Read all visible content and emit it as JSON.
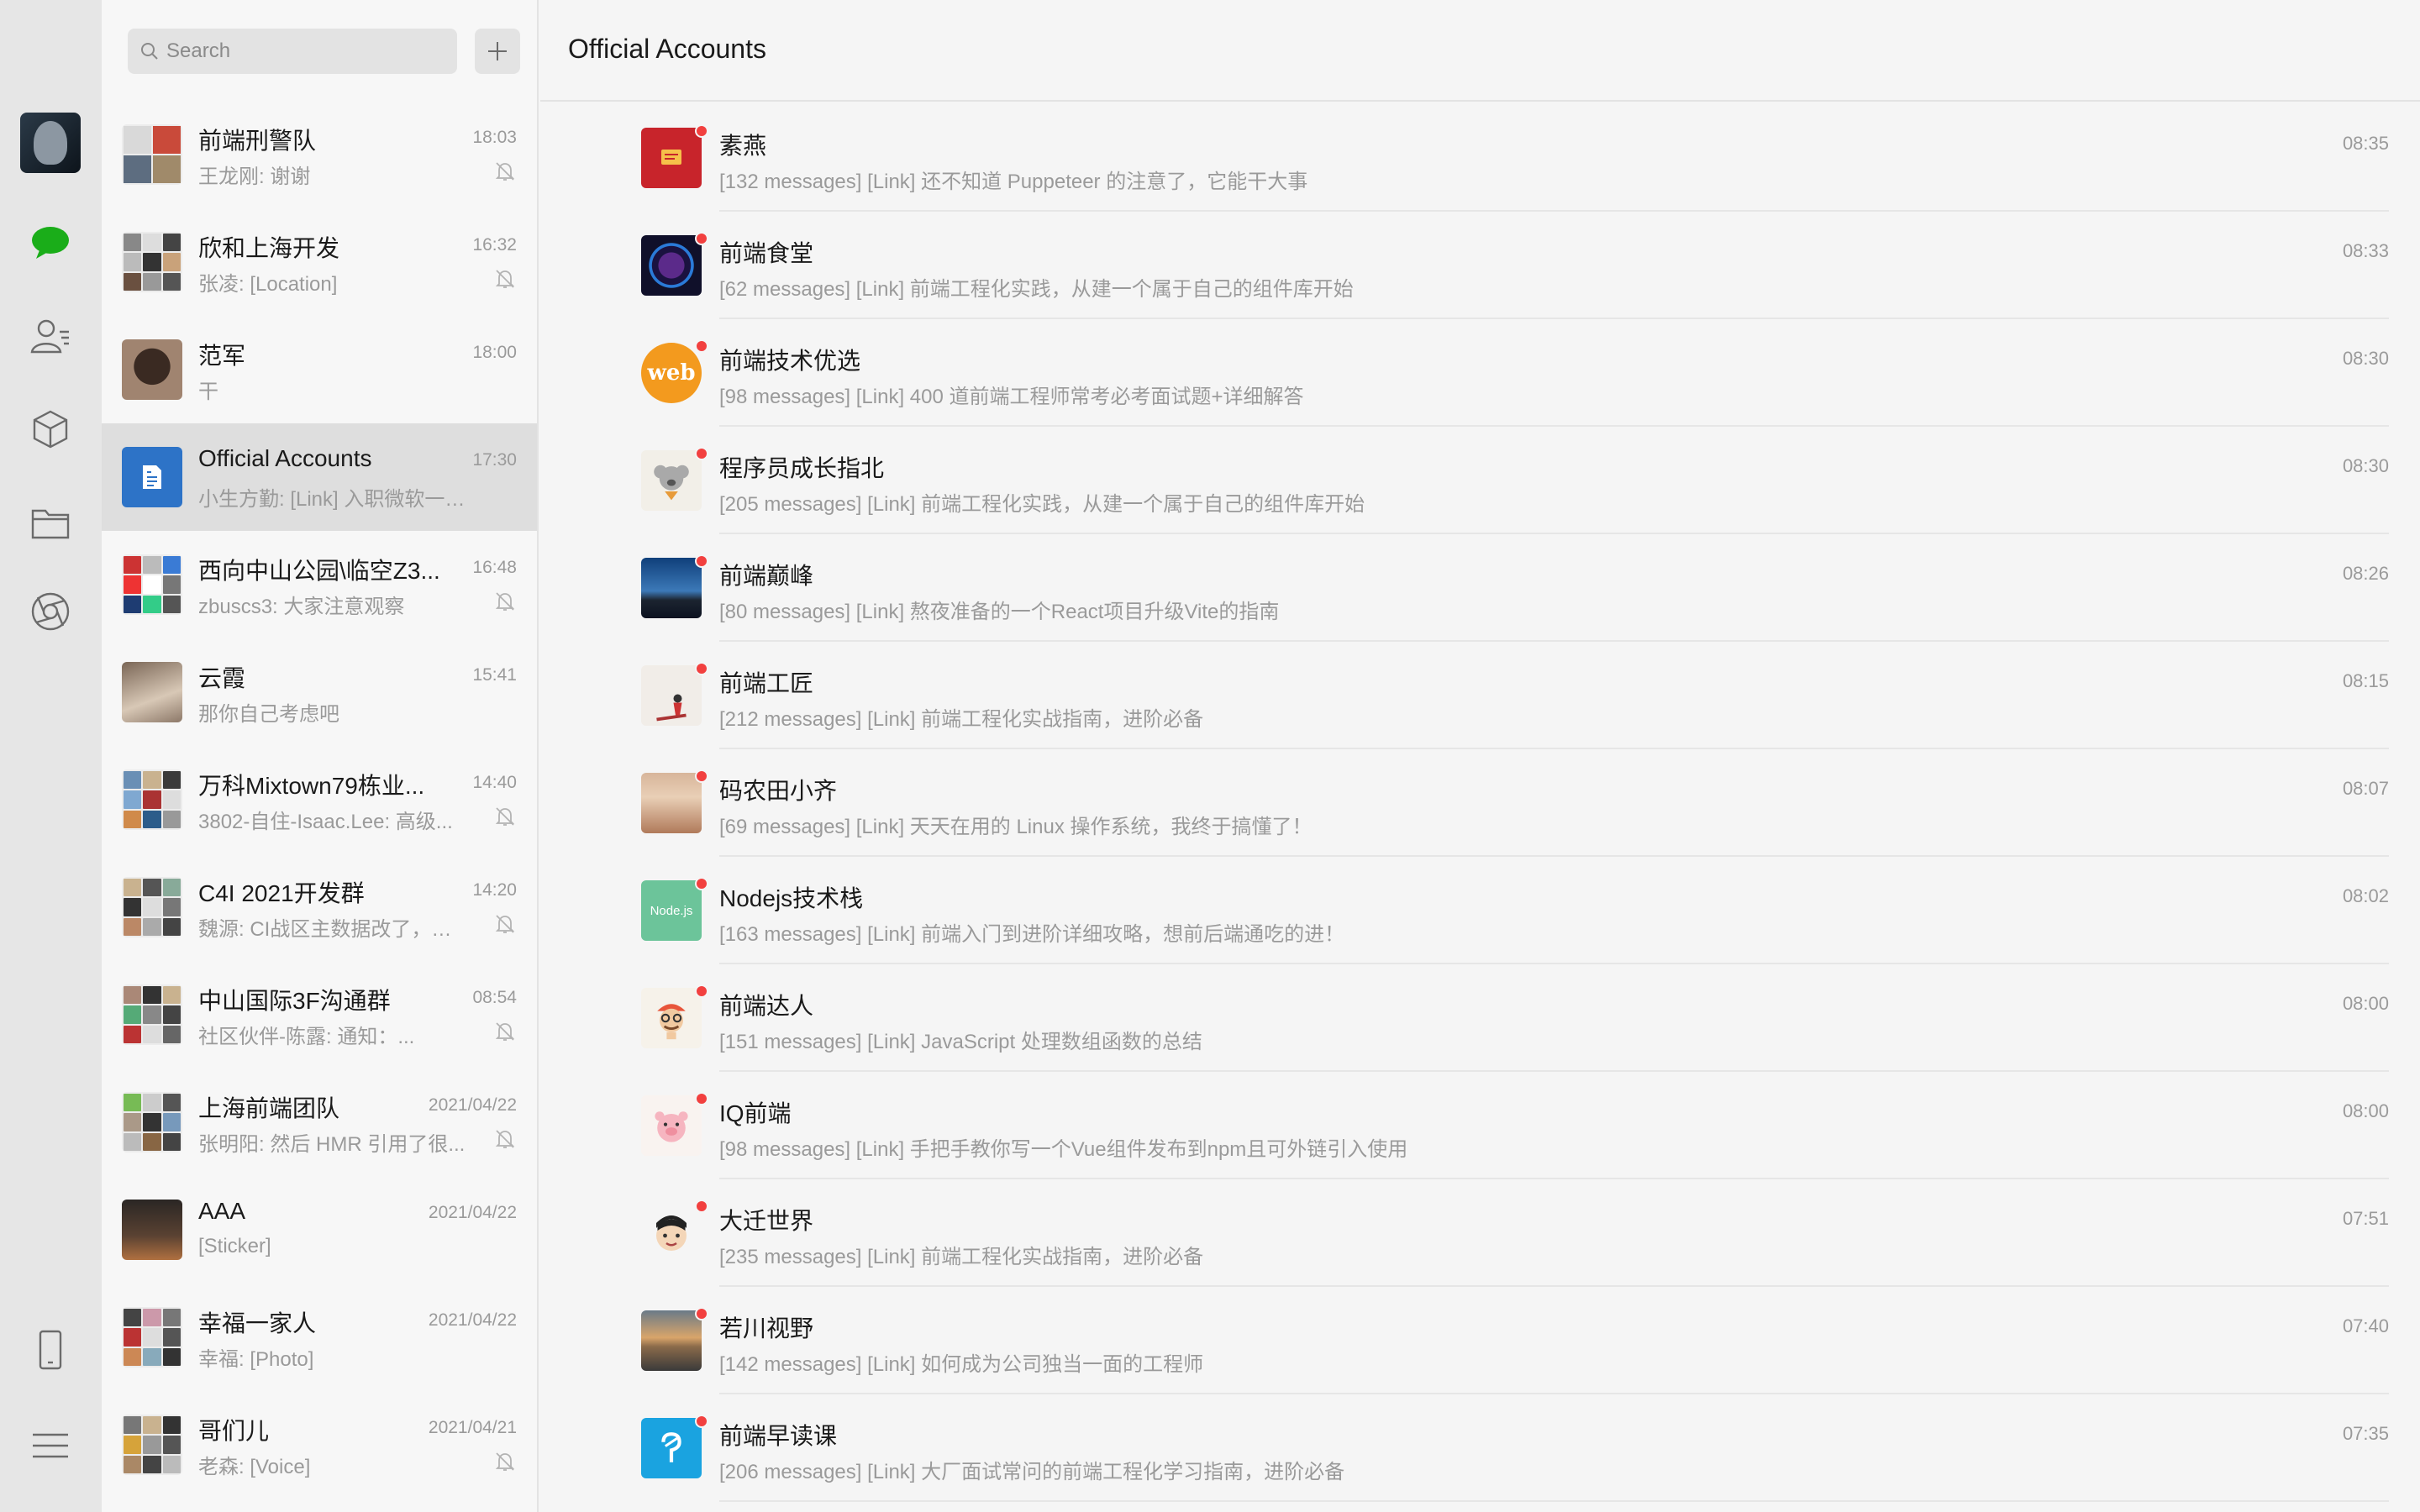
{
  "search": {
    "placeholder": "Search"
  },
  "main": {
    "title": "Official Accounts"
  },
  "colors": {
    "unread_dot": "#f2403f",
    "chat_icon_green": "#1aad19",
    "active_row": "#dedede"
  },
  "rail_icons": [
    "chat-bubble-icon",
    "contacts-icon",
    "cube-icon",
    "folder-icon",
    "aperture-icon",
    "phone-icon",
    "menu-icon"
  ],
  "chats": [
    {
      "name": "前端刑警队",
      "time": "18:03",
      "preview": "王龙刚: 谢谢",
      "muted": true
    },
    {
      "name": "欣和上海开发",
      "time": "16:32",
      "preview": "张凌: [Location]",
      "muted": true
    },
    {
      "name": "范军",
      "time": "18:00",
      "preview": "干",
      "muted": false
    },
    {
      "name": "Official Accounts",
      "time": "17:30",
      "preview": "小生方勤: [Link] 入职微软一个月...",
      "muted": false
    },
    {
      "name": "西向中山公园\\临空Z3...",
      "time": "16:48",
      "preview": "zbuscs3: 大家注意观察",
      "muted": true
    },
    {
      "name": "云霞",
      "time": "15:41",
      "preview": "那你自己考虑吧",
      "muted": false
    },
    {
      "name": "万科Mixtown79栋业...",
      "time": "14:40",
      "preview": "3802-自住-Isaac.Lee: 高级...",
      "muted": true
    },
    {
      "name": "C4I 2021开发群",
      "time": "14:20",
      "preview": "魏源: CI战区主数据改了，相...",
      "muted": true
    },
    {
      "name": "中山国际3F沟通群",
      "time": "08:54",
      "preview": "社区伙伴-陈露: 通知：...",
      "muted": true
    },
    {
      "name": "上海前端团队",
      "time": "2021/04/22",
      "preview": "张明阳: 然后 HMR 引用了很...",
      "muted": true
    },
    {
      "name": "AAA",
      "time": "2021/04/22",
      "preview": "[Sticker]",
      "muted": false
    },
    {
      "name": "幸福一家人",
      "time": "2021/04/22",
      "preview": "幸福: [Photo]",
      "muted": false
    },
    {
      "name": "哥们儿",
      "time": "2021/04/21",
      "preview": "老森: [Voice]",
      "muted": true
    }
  ],
  "accounts": [
    {
      "name": "素燕",
      "time": "08:35",
      "preview": "[132 messages] [Link] 还不知道 Puppeteer 的注意了，它能干大事"
    },
    {
      "name": "前端食堂",
      "time": "08:33",
      "preview": "[62 messages] [Link] 前端工程化实践，从建一个属于自己的组件库开始"
    },
    {
      "name": "前端技术优选",
      "time": "08:30",
      "preview": "[98 messages] [Link] 400 道前端工程师常考必考面试题+详细解答",
      "avatar_text": "web"
    },
    {
      "name": "程序员成长指北",
      "time": "08:30",
      "preview": "[205 messages] [Link] 前端工程化实践，从建一个属于自己的组件库开始"
    },
    {
      "name": "前端巅峰",
      "time": "08:26",
      "preview": "[80 messages] [Link] 熬夜准备的一个React项目升级Vite的指南"
    },
    {
      "name": "前端工匠",
      "time": "08:15",
      "preview": "[212 messages] [Link] 前端工程化实战指南，进阶必备"
    },
    {
      "name": "码农田小齐",
      "time": "08:07",
      "preview": "[69 messages] [Link] 天天在用的 Linux 操作系统，我终于搞懂了！"
    },
    {
      "name": "Nodejs技术栈",
      "time": "08:02",
      "preview": "[163 messages] [Link] 前端入门到进阶详细攻略，想前后端通吃的进！",
      "avatar_text": "Node.js"
    },
    {
      "name": "前端达人",
      "time": "08:00",
      "preview": "[151 messages] [Link] JavaScript 处理数组函数的总结"
    },
    {
      "name": "IQ前端",
      "time": "08:00",
      "preview": "[98 messages] [Link] 手把手教你写一个Vue组件发布到npm且可外链引入使用"
    },
    {
      "name": "大迁世界",
      "time": "07:51",
      "preview": "[235 messages] [Link] 前端工程化实战指南，进阶必备"
    },
    {
      "name": "若川视野",
      "time": "07:40",
      "preview": "[142 messages] [Link] 如何成为公司独当一面的工程师"
    },
    {
      "name": "前端早读课",
      "time": "07:35",
      "preview": "[206 messages] [Link] 大厂面试常问的前端工程化学习指南，进阶必备"
    }
  ]
}
